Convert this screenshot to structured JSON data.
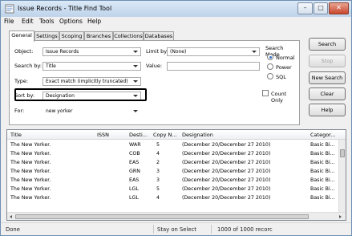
{
  "window": {
    "title": "Issue Records - Title Find Tool",
    "minimize": "–",
    "maximize": "□",
    "close": "✕"
  },
  "menu": [
    "File",
    "Edit",
    "Tools",
    "Options",
    "Help"
  ],
  "tabs": [
    "General",
    "Settings",
    "Scoping",
    "Branches",
    "Collections",
    "Databases"
  ],
  "form": {
    "object_label": "Object:",
    "object_value": "Issue Records",
    "searchby_label": "Search by:",
    "searchby_value": "Title",
    "type_label": "Type:",
    "type_value": "Exact match (implicitly truncated)",
    "sortby_label": "Sort by:",
    "sortby_value": "Designation",
    "for_label": "For:",
    "for_value": "new yorker",
    "limitby_label": "Limit by:",
    "limitby_value": "(None)",
    "value_label": "Value:",
    "value_value": ""
  },
  "search_mode": {
    "label": "Search Mode",
    "options": [
      "Normal",
      "Power",
      "SQL"
    ],
    "selected": "Normal"
  },
  "count_only": {
    "label": "Count Only",
    "checked": false
  },
  "buttons": {
    "search": "Search",
    "stop": "Stop",
    "new_search": "New Search",
    "clear": "Clear",
    "help": "Help"
  },
  "table": {
    "columns": [
      "Title",
      "ISSN",
      "Desti...",
      "Copy N...",
      "Designation",
      "Categor..."
    ],
    "rows": [
      [
        "The New Yorker.",
        "",
        "WAR",
        "5",
        "(December 20/December 27 2010)",
        "Basic Bi..."
      ],
      [
        "The New Yorker.",
        "",
        "COB",
        "4",
        "(December 20/December 27 2010)",
        "Basic Bi..."
      ],
      [
        "The New Yorker.",
        "",
        "EAS",
        "2",
        "(December 20/December 27 2010)",
        "Basic Bi..."
      ],
      [
        "The New Yorker.",
        "",
        "GRN",
        "3",
        "(December 20/December 27 2010)",
        "Basic Bi..."
      ],
      [
        "The New Yorker.",
        "",
        "EAS",
        "3",
        "(December 20/December 27 2010)",
        "Basic Bi..."
      ],
      [
        "The New Yorker.",
        "",
        "LGL",
        "5",
        "(December 20/December 27 2010)",
        "Basic Bi..."
      ],
      [
        "The New Yorker.",
        "",
        "LGL",
        "4",
        "(December 20/December 27 2010)",
        "Basic Bi..."
      ]
    ]
  },
  "status": {
    "left": "Done",
    "middle": "Stay on Select",
    "right": "1000 of 1000 recorc"
  },
  "colors": {
    "accent": "#2b6fc9",
    "titlebar": "#bed3ea",
    "close": "#c9462c"
  }
}
